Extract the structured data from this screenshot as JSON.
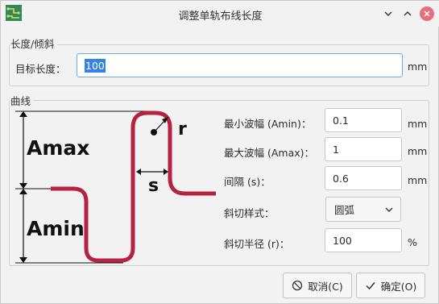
{
  "window": {
    "title": "调整单轨布线长度"
  },
  "length_group": {
    "title": "长度/倾斜",
    "target_label": "目标长度：",
    "target_value": "100",
    "target_unit": "mm"
  },
  "curve_group": {
    "title": "曲线",
    "diagram": {
      "amax_label": "Amax",
      "amin_label": "Amin",
      "s_label": "s",
      "r_label": "r",
      "trace_color": "#b5233f"
    },
    "fields": [
      {
        "label": "最小波幅 (Amin)：",
        "value": "0.1",
        "unit": "mm"
      },
      {
        "label": "最大波幅 (Amax)：",
        "value": "1",
        "unit": "mm"
      },
      {
        "label": "间隔 (s)：",
        "value": "0.6",
        "unit": "mm"
      }
    ],
    "corner_style": {
      "label": "斜切样式：",
      "value": "圆弧"
    },
    "corner_radius": {
      "label": "斜切半径 (r)：",
      "value": "100",
      "unit": "%"
    }
  },
  "buttons": {
    "cancel": "取消(C)",
    "ok": "确定(O)"
  },
  "icons": {
    "app": "pcb-icon",
    "minimize": "chevron-down-icon",
    "maximize": "chevron-up-icon",
    "close": "close-icon",
    "cancel": "cancel-circle-icon",
    "ok": "check-icon"
  }
}
